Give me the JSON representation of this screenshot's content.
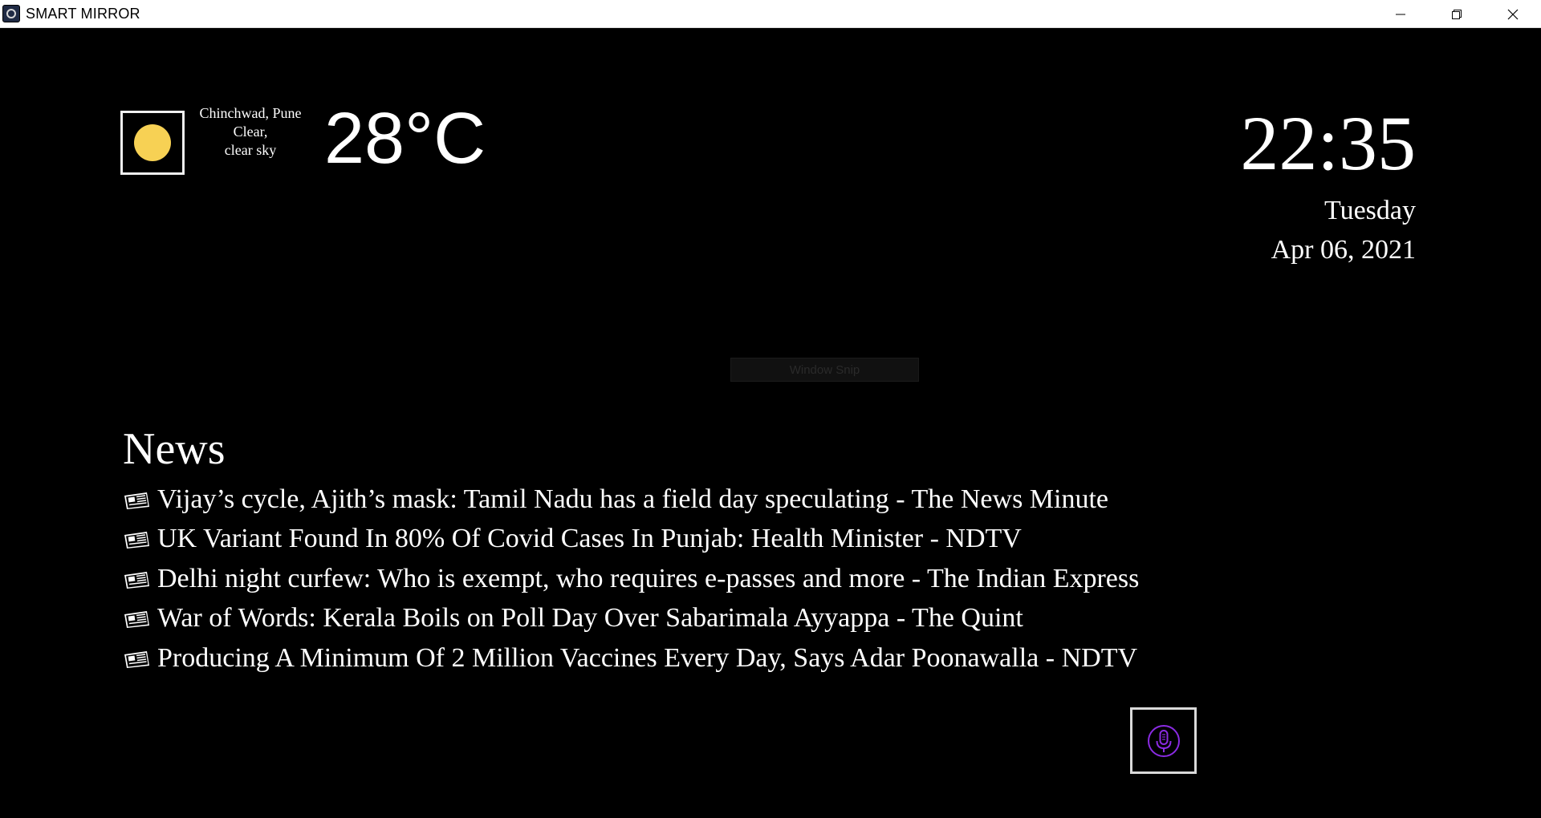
{
  "window": {
    "title": "SMART MIRROR",
    "app_icon": "app-logo-icon",
    "controls": [
      "minimize-icon",
      "restore-icon",
      "close-icon"
    ]
  },
  "weather": {
    "location": "Chinchwad, Pune",
    "condition": "Clear,",
    "description": "clear sky",
    "temperature": "28°C",
    "icon": "sun-icon",
    "icon_color": "#f7d154"
  },
  "clock": {
    "time": "22:35",
    "day": "Tuesday",
    "date": "Apr 06, 2021"
  },
  "overlay": {
    "label": "Window Snip"
  },
  "news": {
    "heading": "News",
    "items": [
      {
        "headline": "Vijay’s cycle, Ajith’s mask: Tamil Nadu has a field day speculating - The News Minute",
        "icon": "newspaper-icon"
      },
      {
        "headline": "UK Variant Found In 80% Of Covid Cases In Punjab: Health Minister - NDTV",
        "icon": "newspaper-icon"
      },
      {
        "headline": "Delhi night curfew: Who is exempt, who requires e-passes and more - The Indian Express",
        "icon": "newspaper-icon"
      },
      {
        "headline": "War of Words: Kerala Boils on Poll Day Over Sabarimala Ayyappa - The Quint",
        "icon": "newspaper-icon"
      },
      {
        "headline": "Producing A Minimum Of 2 Million Vaccines Every Day, Says Adar Poonawalla - NDTV",
        "icon": "newspaper-icon"
      }
    ]
  },
  "voice": {
    "icon": "microphone-icon",
    "accent_color": "#8a2be2"
  }
}
